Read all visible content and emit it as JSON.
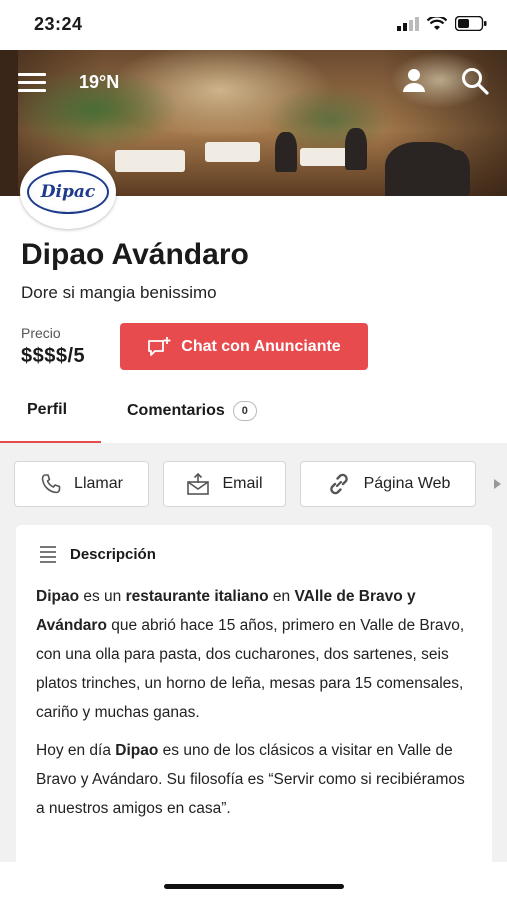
{
  "status_bar": {
    "time": "23:24"
  },
  "hero": {
    "coordinate": "19°N"
  },
  "logo": {
    "text": "Dipac"
  },
  "listing": {
    "title": "Dipao Avándaro",
    "tagline": "Dore si mangia benissimo",
    "price_label": "Precio",
    "price_value": "$$$$/5",
    "chat_button": "Chat con Anunciante"
  },
  "tabs": [
    {
      "label": "Perfil",
      "active": true
    },
    {
      "label": "Comentarios",
      "badge": "0",
      "active": false
    }
  ],
  "actions": {
    "call": "Llamar",
    "email": "Email",
    "web": "Página Web"
  },
  "description": {
    "header": "Descripción",
    "p1": [
      {
        "text": "Dipao",
        "bold": true
      },
      {
        "text": " es un ",
        "bold": false
      },
      {
        "text": "restaurante italiano",
        "bold": true
      },
      {
        "text": " en ",
        "bold": false
      },
      {
        "text": "VAlle de Bravo y Avándaro",
        "bold": true
      },
      {
        "text": " que abrió hace 15 años, primero en Valle de Bravo, con una olla para pasta, dos cucharones, dos sartenes, seis platos trinches, un horno de leña, mesas para 15 comensales, cariño y muchas ganas.",
        "bold": false
      }
    ],
    "p2": [
      {
        "text": "Hoy en día ",
        "bold": false
      },
      {
        "text": "Dipao",
        "bold": true
      },
      {
        "text": " es uno de los clásicos a visitar en Valle de Bravo y Avándaro. Su filosofía es “Servir como si recibiéramos a nuestros amigos en casa”.",
        "bold": false
      }
    ]
  },
  "colors": {
    "accent": "#e84b4e",
    "logo_blue": "#1e3a8a"
  }
}
